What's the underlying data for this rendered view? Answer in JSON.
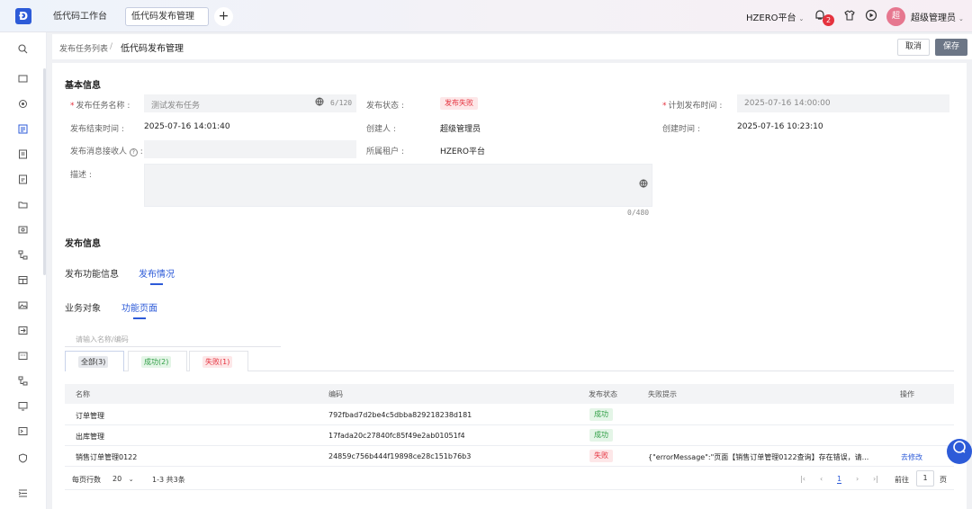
{
  "topbar": {
    "logo": "Ð",
    "tabs": [
      "低代码工作台",
      "低代码发布管理"
    ],
    "add_tab": "+",
    "tenant": "HZERO平台",
    "tenant_chevron": "⌄",
    "notification_count": "2",
    "avatar_text": "超",
    "user_name": "超级管理员",
    "icons": {
      "bell": "bell-icon",
      "shirt": "theme-icon",
      "play": "play-icon"
    }
  },
  "breadcrumb": {
    "parent": "发布任务列表",
    "separator": "/",
    "current": "低代码发布管理"
  },
  "actions": {
    "cancel": "取消",
    "save": "保存"
  },
  "basic_info": {
    "title": "基本信息",
    "task_name_label": "发布任务名称",
    "task_name_value": "测试发布任务",
    "task_name_count": "6/120",
    "status_label": "发布状态",
    "status_value": "发布失败",
    "plan_time_label": "计划发布时间",
    "plan_time_value": "2025-07-16 14:00:00",
    "end_time_label": "发布结束时间",
    "end_time_value": "2025-07-16 14:01:40",
    "creator_label": "创建人",
    "creator_value": "超级管理员",
    "create_time_label": "创建时间",
    "create_time_value": "2025-07-16 10:23:10",
    "receiver_label": "发布消息接收人",
    "tenant_label": "所属租户",
    "tenant_value": "HZERO平台",
    "desc_label": "描述",
    "desc_count": "0/480"
  },
  "publish_info": {
    "title": "发布信息",
    "tabs": [
      "发布功能信息",
      "发布情况"
    ],
    "sub_tabs": [
      "业务对象",
      "功能页面"
    ],
    "search_placeholder": "请输入名称/编码",
    "filters": [
      {
        "label": "全部(3)"
      },
      {
        "label": "成功(2)"
      },
      {
        "label": "失败(1)"
      }
    ]
  },
  "table": {
    "columns": [
      "名称",
      "编码",
      "发布状态",
      "失败提示",
      "操作"
    ],
    "rows": [
      {
        "name": "订单管理",
        "code": "792fbad7d2be4c5dbba829218238d181",
        "status": "成功",
        "error": "",
        "action": ""
      },
      {
        "name": "出库管理",
        "code": "17fada20c27840fc85f49e2ab01051f4",
        "status": "成功",
        "error": "",
        "action": ""
      },
      {
        "name": "销售订单管理0122",
        "code": "24859c756b444f19898ce28c151b76b3",
        "status": "失败",
        "error": "{\"errorMessage\":\"页面【销售订单管理0122查询】存在错误，请...",
        "action": "去修改"
      }
    ]
  },
  "pagination": {
    "rows_per_page_label": "每页行数",
    "rows_per_page": "20",
    "range": "1-3 共3条",
    "current_page": "1",
    "goto_label": "前往",
    "goto_value": "1",
    "page_unit": "页"
  },
  "colors": {
    "accent": "#2d5bd8",
    "danger": "#e5323e",
    "success": "#2f9e45"
  }
}
